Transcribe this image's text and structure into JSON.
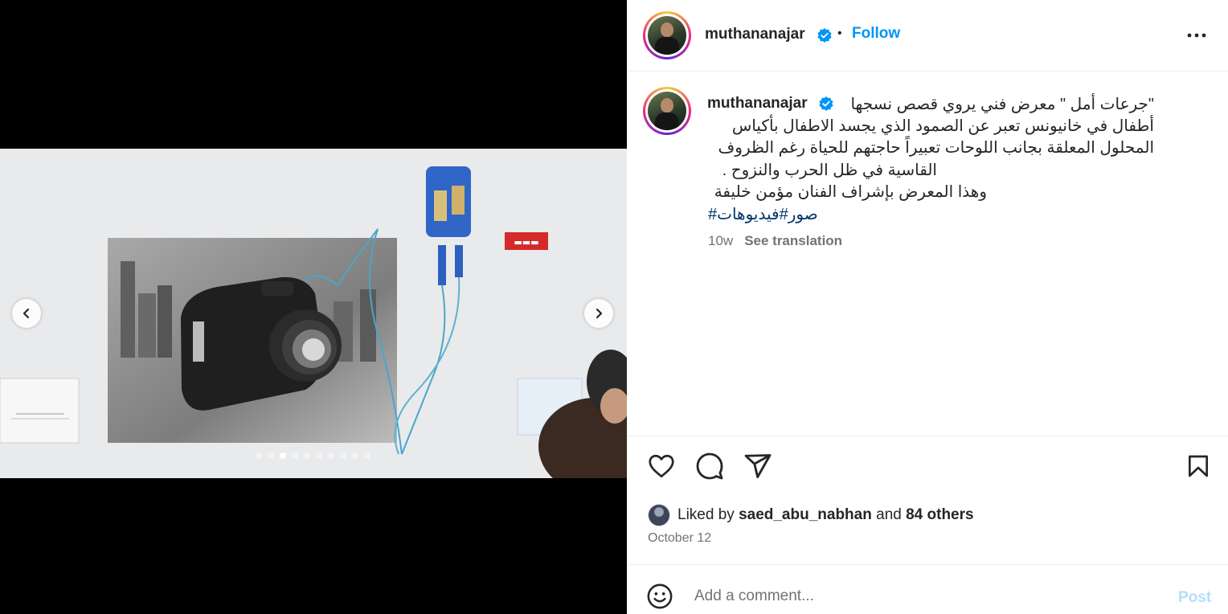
{
  "post": {
    "username": "muthananajar",
    "follow_label": "Follow",
    "bullet": "•",
    "verified_icon": "verified-badge-icon",
    "more_icon": "more-options-icon"
  },
  "media": {
    "carousel_dots": 10,
    "active_dot": 2,
    "prev_icon": "chevron-left-icon",
    "next_icon": "chevron-right-icon"
  },
  "caption": {
    "username": "muthananajar",
    "line1": "\"جرعات أمل \" معرض فني يروي قصص نسجها",
    "line2": "أطفال في خانيونس تعبر عن الصمود الذي يجسد الاطفال بأكياس",
    "line3": "المحلول المعلقة بجانب اللوحات تعبيراً حاجتهم للحياة رغم الظروف",
    "line4": "القاسية في ظل الحرب والنزوح .",
    "line5": "وهذا المعرض بإشراف الفنان مؤمن خليفة",
    "hashtag1": "#صور",
    "hashtag2": "#فيديوهات",
    "age": "10w",
    "see_translation": "See translation"
  },
  "likes": {
    "prefix": "Liked by",
    "user": "saed_abu_nabhan",
    "and": "and",
    "others": "84 others"
  },
  "date": "October 12",
  "comment": {
    "placeholder": "Add a comment...",
    "post_label": "Post"
  },
  "colors": {
    "accent": "#0095f6",
    "hashtag": "#00376b",
    "muted": "#737373",
    "post_disabled": "#b2dffc"
  }
}
